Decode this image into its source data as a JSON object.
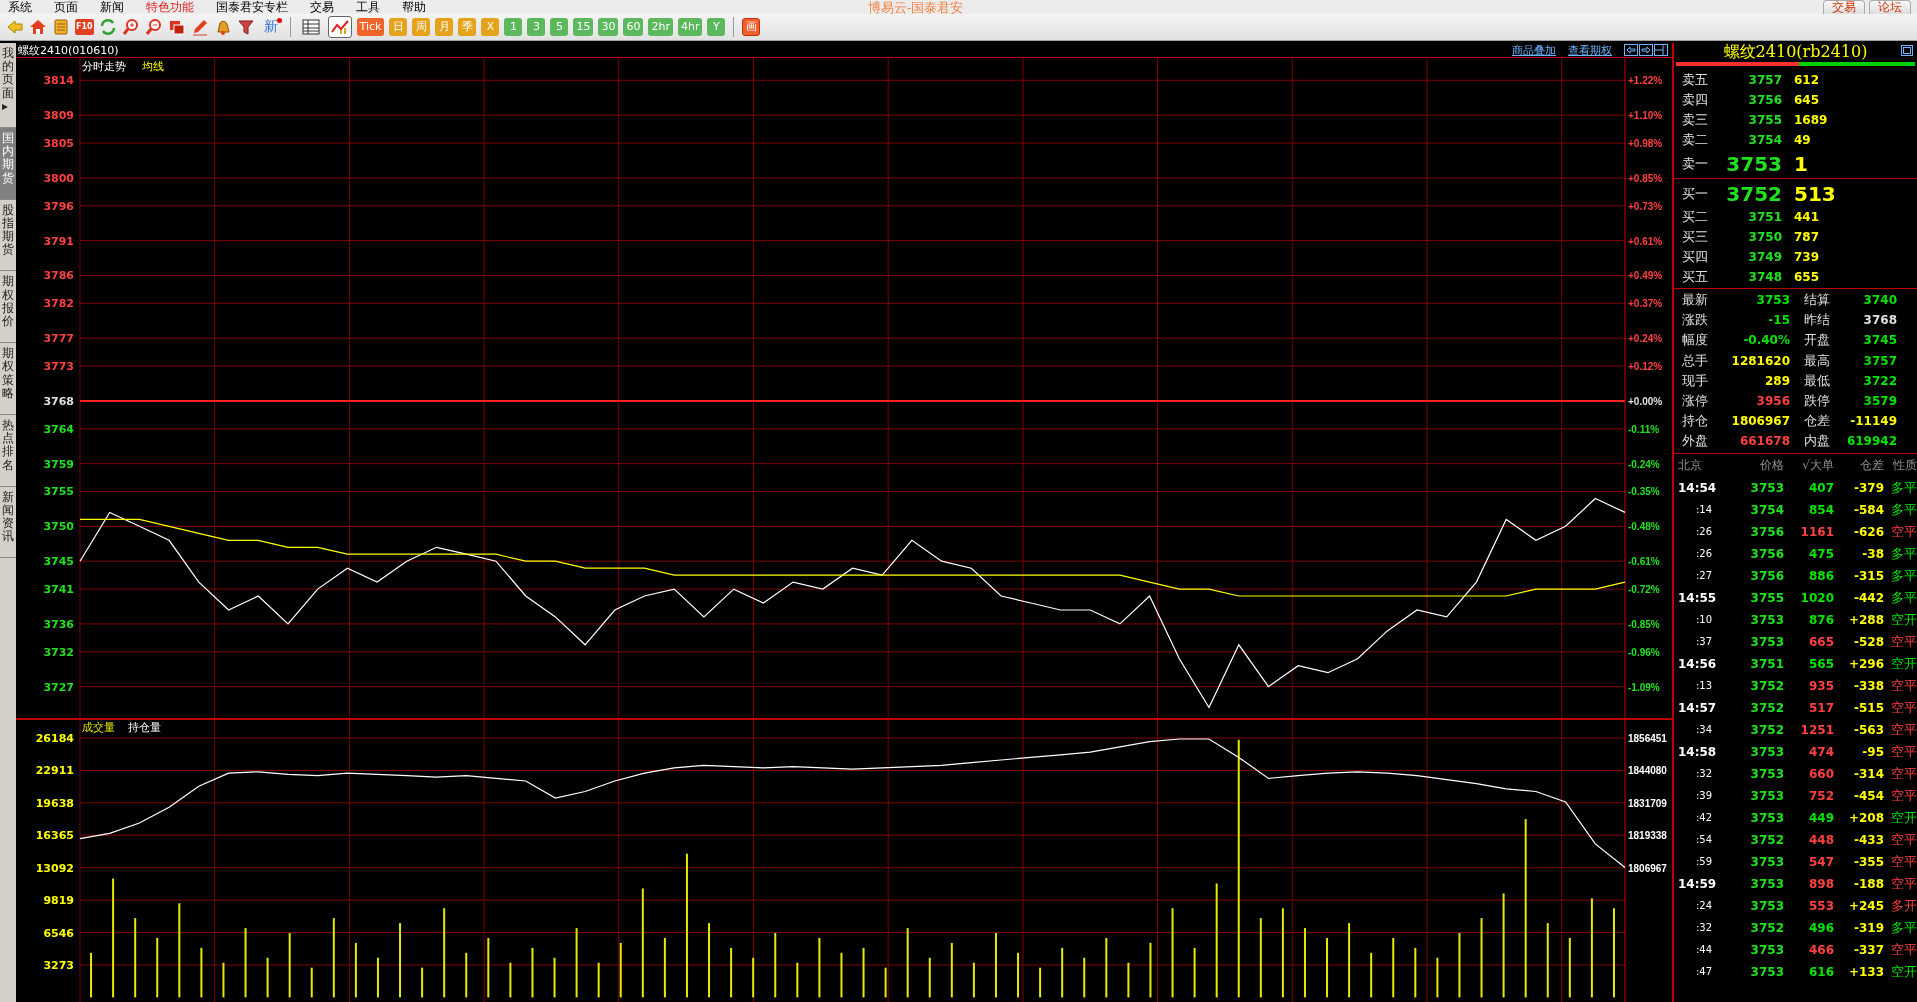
{
  "menu": [
    {
      "label": "系统",
      "selected": false
    },
    {
      "label": "页面",
      "selected": false
    },
    {
      "label": "新闻",
      "selected": false
    },
    {
      "label": "特色功能",
      "selected": true
    },
    {
      "label": "国泰君安专栏",
      "selected": false
    },
    {
      "label": "交易",
      "selected": false
    },
    {
      "label": "工具",
      "selected": false
    },
    {
      "label": "帮助",
      "selected": false
    }
  ],
  "window": {
    "title": "博易云-国泰君安",
    "buttons": [
      "交易",
      "论坛"
    ]
  },
  "toolbar": {
    "f10": "F10",
    "news": "新",
    "view_buttons": [
      {
        "selected": false
      },
      {
        "selected": true
      }
    ],
    "periods": [
      {
        "label": "Tick",
        "color": "#f0642a"
      },
      {
        "label": "日",
        "color": "#e5a21c"
      },
      {
        "label": "周",
        "color": "#e5a21c"
      },
      {
        "label": "月",
        "color": "#e5a21c"
      },
      {
        "label": "季",
        "color": "#e5a21c"
      },
      {
        "label": "X",
        "color": "#e5a21c"
      },
      {
        "label": "1",
        "color": "#5cb85c"
      },
      {
        "label": "3",
        "color": "#5cb85c"
      },
      {
        "label": "5",
        "color": "#5cb85c"
      },
      {
        "label": "15",
        "color": "#5cb85c"
      },
      {
        "label": "30",
        "color": "#5cb85c"
      },
      {
        "label": "60",
        "color": "#5cb85c"
      },
      {
        "label": "2hr",
        "color": "#5cb85c"
      },
      {
        "label": "4hr",
        "color": "#5cb85c"
      },
      {
        "label": "Y",
        "color": "#5cb85c"
      }
    ],
    "draw": "画"
  },
  "side_tabs": [
    {
      "label": "我的页面▸",
      "selected": false
    },
    {
      "label": "国内期货",
      "selected": true
    },
    {
      "label": "股指期货",
      "selected": false
    },
    {
      "label": "期权报价",
      "selected": false
    },
    {
      "label": "期权策略",
      "selected": false
    },
    {
      "label": "热点排名",
      "selected": false
    },
    {
      "label": "新闻资讯",
      "selected": false
    }
  ],
  "chart_header": {
    "symbol": "螺纹2410(010610)",
    "links": [
      "商品叠加",
      "查看期权"
    ]
  },
  "price_chart": {
    "percent_labels": [
      "+1.22%",
      "+1.10%",
      "+0.98%",
      "+0.85%",
      "+0.73%",
      "+0.61%",
      "+0.49%",
      "+0.37%",
      "+0.24%",
      "+0.12%",
      "+0.00%",
      "-0.11%",
      "-0.24%",
      "-0.35%",
      "-0.48%",
      "-0.61%",
      "-0.72%",
      "-0.85%",
      "-0.96%",
      "-1.09%"
    ],
    "chart_data": {
      "type": "line",
      "grid": true,
      "ref_lines": [
        {
          "axis": "y",
          "value": 3768
        }
      ],
      "ylim": [
        3722.5,
        3817.2
      ],
      "yticks": [
        3814,
        3809,
        3805,
        3800,
        3796,
        3791,
        3786,
        3782,
        3777,
        3773,
        3768,
        3764,
        3759,
        3755,
        3750,
        3745,
        3741,
        3736,
        3732,
        3727
      ],
      "series": [
        {
          "name": "分时走势",
          "color": "#ffffff",
          "values": [
            3745,
            3752,
            3750,
            3748,
            3742,
            3738,
            3740,
            3736,
            3741,
            3744,
            3742,
            3745,
            3747,
            3746,
            3745,
            3740,
            3737,
            3733,
            3738,
            3740,
            3741,
            3737,
            3741,
            3739,
            3742,
            3741,
            3744,
            3743,
            3748,
            3745,
            3744,
            3740,
            3739,
            3738,
            3738,
            3736,
            3740,
            3731,
            3724,
            3733,
            3727,
            3730,
            3729,
            3731,
            3735,
            3738,
            3737,
            3742,
            3751,
            3748,
            3750,
            3754,
            3752
          ]
        },
        {
          "name": "均线",
          "color": "#ffff00",
          "values": [
            3751,
            3751,
            3751,
            3750,
            3749,
            3748,
            3748,
            3747,
            3747,
            3746,
            3746,
            3746,
            3746,
            3746,
            3746,
            3745,
            3745,
            3744,
            3744,
            3744,
            3743,
            3743,
            3743,
            3743,
            3743,
            3743,
            3743,
            3743,
            3743,
            3743,
            3743,
            3743,
            3743,
            3743,
            3743,
            3743,
            3742,
            3741,
            3741,
            3740,
            3740,
            3740,
            3740,
            3740,
            3740,
            3740,
            3740,
            3740,
            3740,
            3741,
            3741,
            3741,
            3742
          ]
        }
      ]
    }
  },
  "volume_chart": {
    "chart_data": {
      "type": "bar",
      "grid": true,
      "ylim": [
        0,
        28102
      ],
      "yticks": [
        26184,
        22911,
        19638,
        16365,
        13092,
        9819,
        6546,
        3273
      ],
      "series": [
        {
          "name": "成交量",
          "color": "#e8e800",
          "values": [
            4500,
            12000,
            8000,
            6000,
            9500,
            5000,
            3500,
            7000,
            4000,
            6500,
            3000,
            8000,
            5500,
            4000,
            7500,
            3000,
            9000,
            4500,
            6000,
            3500,
            5000,
            4000,
            7000,
            3500,
            5500,
            11000,
            6000,
            14500,
            7500,
            5000,
            4000,
            6500,
            3500,
            6000,
            4500,
            5000,
            3000,
            7000,
            4000,
            5500,
            3500,
            6500,
            4500,
            3000,
            5000,
            4000,
            6000,
            3500,
            5500,
            9000,
            5000,
            11500,
            26000,
            8000,
            9000,
            7000,
            6000,
            7500,
            4500,
            6000,
            5000,
            4000,
            6500,
            8000,
            10500,
            18000,
            7500,
            6000,
            10000,
            9000
          ]
        }
      ]
    }
  },
  "oi_chart": {
    "chart_data": {
      "type": "line",
      "ylim": [
        1753058,
        1863639
      ],
      "yticks": [
        1856451,
        1844080,
        1831709,
        1819338,
        1806967
      ],
      "series": [
        {
          "name": "持仓量",
          "color": "#ffffff",
          "values": [
            1818000,
            1820000,
            1824000,
            1830000,
            1838000,
            1843000,
            1843500,
            1842500,
            1842000,
            1843000,
            1842500,
            1842000,
            1841500,
            1842000,
            1841000,
            1840000,
            1833500,
            1836000,
            1840000,
            1843000,
            1845000,
            1846000,
            1845500,
            1845000,
            1845500,
            1845000,
            1844500,
            1845000,
            1845500,
            1846000,
            1847000,
            1848000,
            1849000,
            1850000,
            1851000,
            1853000,
            1855000,
            1856000,
            1856000,
            1849000,
            1841000,
            1842000,
            1843000,
            1843500,
            1843000,
            1842000,
            1840500,
            1839000,
            1837000,
            1836000,
            1832000,
            1816000,
            1807000
          ]
        }
      ]
    }
  },
  "quote": {
    "title": "螺纹2410(rb2410)",
    "outer_share": {
      "level": 0.516
    },
    "asks": [
      {
        "label": "卖五",
        "price": "3757",
        "volume": "612"
      },
      {
        "label": "卖四",
        "price": "3756",
        "volume": "645"
      },
      {
        "label": "卖三",
        "price": "3755",
        "volume": "1689"
      },
      {
        "label": "卖二",
        "price": "3754",
        "volume": "49"
      },
      {
        "label": "卖一",
        "price": "3753",
        "volume": "1"
      }
    ],
    "bids": [
      {
        "label": "买一",
        "price": "3752",
        "volume": "513"
      },
      {
        "label": "买二",
        "price": "3751",
        "volume": "441"
      },
      {
        "label": "买三",
        "price": "3750",
        "volume": "787"
      },
      {
        "label": "买四",
        "price": "3749",
        "volume": "739"
      },
      {
        "label": "买五",
        "price": "3748",
        "volume": "655"
      }
    ],
    "stats": [
      {
        "label": "最新",
        "value": "3753",
        "color": "#00e600"
      },
      {
        "label": "结算",
        "value": "3740",
        "color": "#00e600"
      },
      {
        "label": "涨跌",
        "value": "-15",
        "color": "#00e600"
      },
      {
        "label": "昨结",
        "value": "3768",
        "color": "#e0e0e0"
      },
      {
        "label": "幅度",
        "value": "-0.40%",
        "color": "#00e600"
      },
      {
        "label": "开盘",
        "value": "3745",
        "color": "#00e600"
      },
      {
        "label": "总手",
        "value": "1281620",
        "color": "#ffff00"
      },
      {
        "label": "最高",
        "value": "3757",
        "color": "#00e600"
      },
      {
        "label": "现手",
        "value": "289",
        "color": "#ffff00"
      },
      {
        "label": "最低",
        "value": "3722",
        "color": "#00e600"
      },
      {
        "label": "涨停",
        "value": "3956",
        "color": "#ff4040"
      },
      {
        "label": "跌停",
        "value": "3579",
        "color": "#00e600"
      },
      {
        "label": "持仓",
        "value": "1806967",
        "color": "#ffff00"
      },
      {
        "label": "仓差",
        "value": "-11149",
        "color": "#ffff00"
      },
      {
        "label": "外盘",
        "value": "661678",
        "color": "#ff4040"
      },
      {
        "label": "内盘",
        "value": "619942",
        "color": "#00e600"
      }
    ],
    "tick_columns": [
      "北京",
      "价格",
      "√大单",
      "仓差",
      "性质"
    ],
    "ticks": [
      {
        "time": "14:54",
        "kind": "minute",
        "price": "3753",
        "volume": "407",
        "oi": "-379",
        "nature": "多平",
        "color": "#00e600"
      },
      {
        "time": ":14",
        "kind": "second",
        "price": "3754",
        "volume": "854",
        "oi": "-584",
        "nature": "多平",
        "color": "#00e600"
      },
      {
        "time": ":26",
        "kind": "second",
        "price": "3756",
        "volume": "1161",
        "oi": "-626",
        "nature": "空平",
        "color": "#ff4040"
      },
      {
        "time": ":26",
        "kind": "second",
        "price": "3756",
        "volume": "475",
        "oi": "-38",
        "nature": "多平",
        "color": "#00e600"
      },
      {
        "time": ":27",
        "kind": "second",
        "price": "3756",
        "volume": "886",
        "oi": "-315",
        "nature": "多平",
        "color": "#00e600"
      },
      {
        "time": "14:55",
        "kind": "minute",
        "price": "3755",
        "volume": "1020",
        "oi": "-442",
        "nature": "多平",
        "color": "#00e600"
      },
      {
        "time": ":10",
        "kind": "second",
        "price": "3753",
        "volume": "876",
        "oi": "+288",
        "nature": "空开",
        "color": "#00e600"
      },
      {
        "time": ":37",
        "kind": "second",
        "price": "3753",
        "volume": "665",
        "oi": "-528",
        "nature": "空平",
        "color": "#ff4040"
      },
      {
        "time": "14:56",
        "kind": "minute",
        "price": "3751",
        "volume": "565",
        "oi": "+296",
        "nature": "空开",
        "color": "#00e600"
      },
      {
        "time": ":13",
        "kind": "second",
        "price": "3752",
        "volume": "935",
        "oi": "-338",
        "nature": "空平",
        "color": "#ff4040"
      },
      {
        "time": "14:57",
        "kind": "minute",
        "price": "3752",
        "volume": "517",
        "oi": "-515",
        "nature": "空平",
        "color": "#ff4040"
      },
      {
        "time": ":34",
        "kind": "second",
        "price": "3752",
        "volume": "1251",
        "oi": "-563",
        "nature": "空平",
        "color": "#ff4040"
      },
      {
        "time": "14:58",
        "kind": "minute",
        "price": "3753",
        "volume": "474",
        "oi": "-95",
        "nature": "空平",
        "color": "#ff4040"
      },
      {
        "time": ":32",
        "kind": "second",
        "price": "3753",
        "volume": "660",
        "oi": "-314",
        "nature": "空平",
        "color": "#ff4040"
      },
      {
        "time": ":39",
        "kind": "second",
        "price": "3753",
        "volume": "752",
        "oi": "-454",
        "nature": "空平",
        "color": "#ff4040"
      },
      {
        "time": ":42",
        "kind": "second",
        "price": "3753",
        "volume": "449",
        "oi": "+208",
        "nature": "空开",
        "color": "#00e600"
      },
      {
        "time": ":54",
        "kind": "second",
        "price": "3752",
        "volume": "448",
        "oi": "-433",
        "nature": "空平",
        "color": "#ff4040"
      },
      {
        "time": ":59",
        "kind": "second",
        "price": "3753",
        "volume": "547",
        "oi": "-355",
        "nature": "空平",
        "color": "#ff4040"
      },
      {
        "time": "14:59",
        "kind": "minute",
        "price": "3753",
        "volume": "898",
        "oi": "-188",
        "nature": "空平",
        "color": "#ff4040"
      },
      {
        "time": ":24",
        "kind": "second",
        "price": "3753",
        "volume": "553",
        "oi": "+245",
        "nature": "多开",
        "color": "#ff4040"
      },
      {
        "time": ":32",
        "kind": "second",
        "price": "3752",
        "volume": "496",
        "oi": "-319",
        "nature": "多平",
        "color": "#00e600"
      },
      {
        "time": ":44",
        "kind": "second",
        "price": "3753",
        "volume": "466",
        "oi": "-337",
        "nature": "空平",
        "color": "#ff4040"
      },
      {
        "time": ":47",
        "kind": "second",
        "price": "3753",
        "volume": "616",
        "oi": "+133",
        "nature": "空开",
        "color": "#00e600"
      }
    ]
  }
}
